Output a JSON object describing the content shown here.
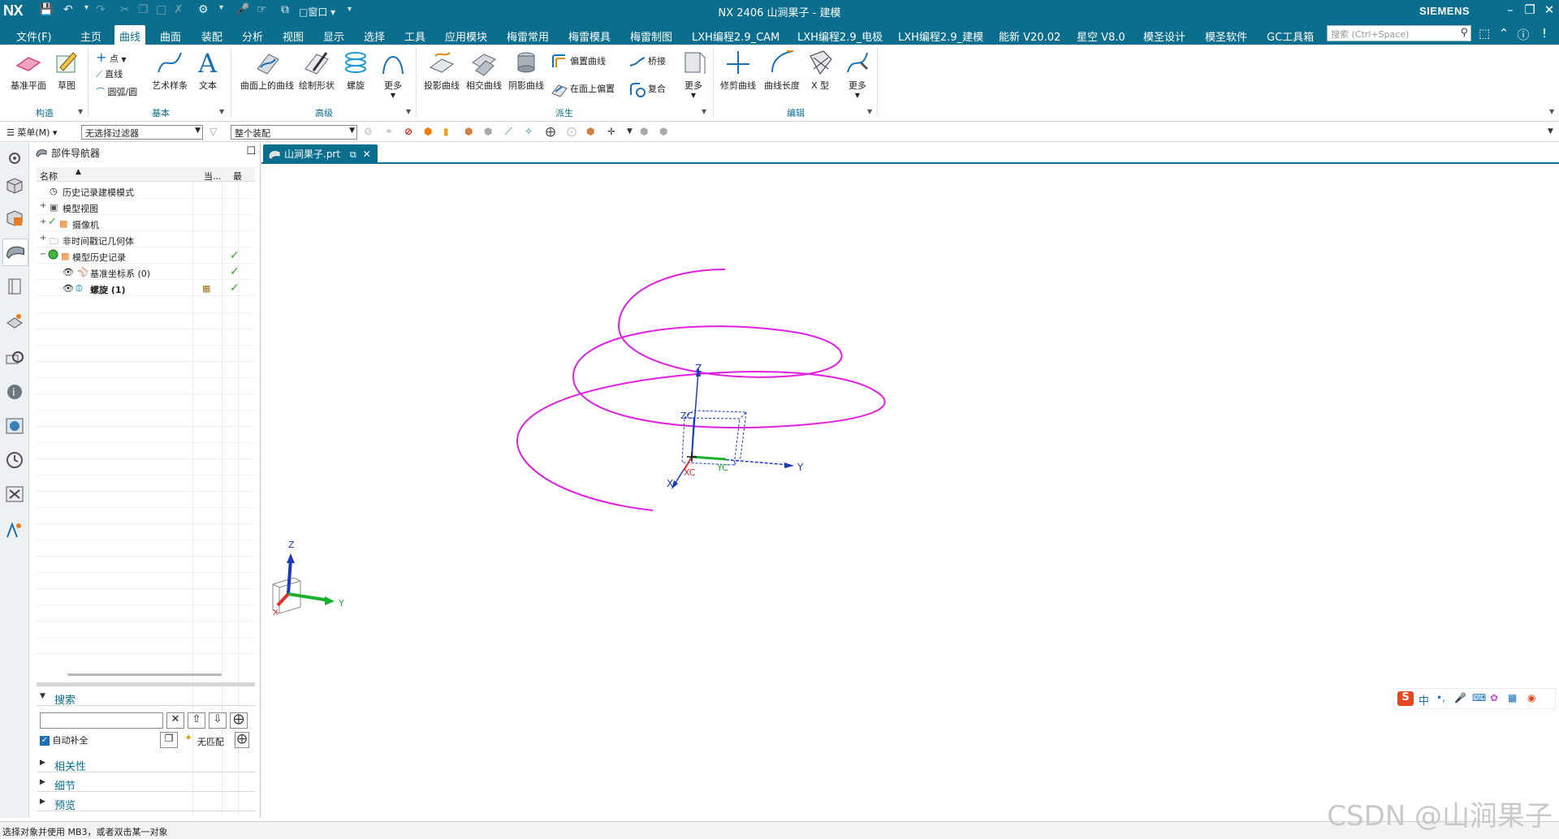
{
  "titlebar": {
    "logo": "NX",
    "title": "NX 2406  山涧果子 - 建模",
    "brand": "SIEMENS",
    "window_menu": "窗口"
  },
  "menubar": {
    "tabs": [
      "文件(F)",
      "主页",
      "曲线",
      "曲面",
      "装配",
      "分析",
      "视图",
      "显示",
      "选择",
      "工具",
      "应用模块",
      "梅雷常用",
      "梅雷模具",
      "梅雷制图",
      "LXH编程2.9_CAM",
      "LXH编程2.9_电极",
      "LXH编程2.9_建模",
      "能新 V20.02",
      "星空 V8.0",
      "模圣设计",
      "模圣软件",
      "GC工具箱"
    ],
    "active_tab": "曲线",
    "search_placeholder": "搜索 (Ctrl+Space)"
  },
  "ribbon": {
    "groups": {
      "construct": {
        "label": "构造",
        "buttons": [
          "基准平面",
          "草图"
        ]
      },
      "basic": {
        "label": "基本",
        "small_buttons": [
          "点",
          "直线",
          "圆弧/圆"
        ],
        "buttons": [
          "艺术样条",
          "文本"
        ]
      },
      "advanced": {
        "label": "高级",
        "buttons": [
          "曲面上的曲线",
          "绘制形状",
          "螺旋",
          "更多"
        ]
      },
      "derived": {
        "label": "派生",
        "buttons": [
          "投影曲线",
          "相交曲线",
          "阴影曲线"
        ],
        "small_buttons": [
          "偏置曲线",
          "在面上偏置",
          "桥接",
          "复合"
        ],
        "more": "更多"
      },
      "edit": {
        "label": "编辑",
        "buttons": [
          "修剪曲线",
          "曲线长度",
          "X 型",
          "更多"
        ]
      }
    }
  },
  "toolbar": {
    "menu_label": "菜单(M)",
    "filter_value": "无选择过滤器",
    "scope_value": "整个装配"
  },
  "navigator": {
    "title": "部件导航器",
    "columns": [
      "名称",
      "当...",
      "最"
    ],
    "rows": [
      {
        "label": "历史记录建模模式",
        "expander": "",
        "check": false,
        "indent": 1
      },
      {
        "label": "模型视图",
        "expander": "+",
        "check": false,
        "indent": 1
      },
      {
        "label": "摄像机",
        "expander": "+",
        "check": false,
        "indent": 1
      },
      {
        "label": "非时间戳记几何体",
        "expander": "+",
        "check": false,
        "indent": 1
      },
      {
        "label": "模型历史记录",
        "expander": "−",
        "check": true,
        "indent": 1
      },
      {
        "label": "基准坐标系 (0)",
        "expander": "",
        "check": true,
        "indent": 2
      },
      {
        "label": "螺旋 (1)",
        "expander": "",
        "check": true,
        "indent": 2
      }
    ],
    "search": {
      "label": "搜索",
      "auto_complete": "自动补全",
      "no_match": "无匹配"
    },
    "panels": [
      "相关性",
      "细节",
      "预览"
    ]
  },
  "document": {
    "tab_label": "山涧果子.prt"
  },
  "viewport": {
    "helix_color": "#e020e0",
    "axes": {
      "z": "Z",
      "y": "Y",
      "x": "X",
      "zc": "ZC",
      "yc": "YC",
      "xc": "XC"
    },
    "triad": {
      "z": "Z",
      "y": "Y",
      "x": "X"
    }
  },
  "status": {
    "message": "选择对象并使用 MB3，或者双击某一对象"
  },
  "watermark": "CSDN @山涧果子",
  "ime": {
    "label": "中"
  }
}
